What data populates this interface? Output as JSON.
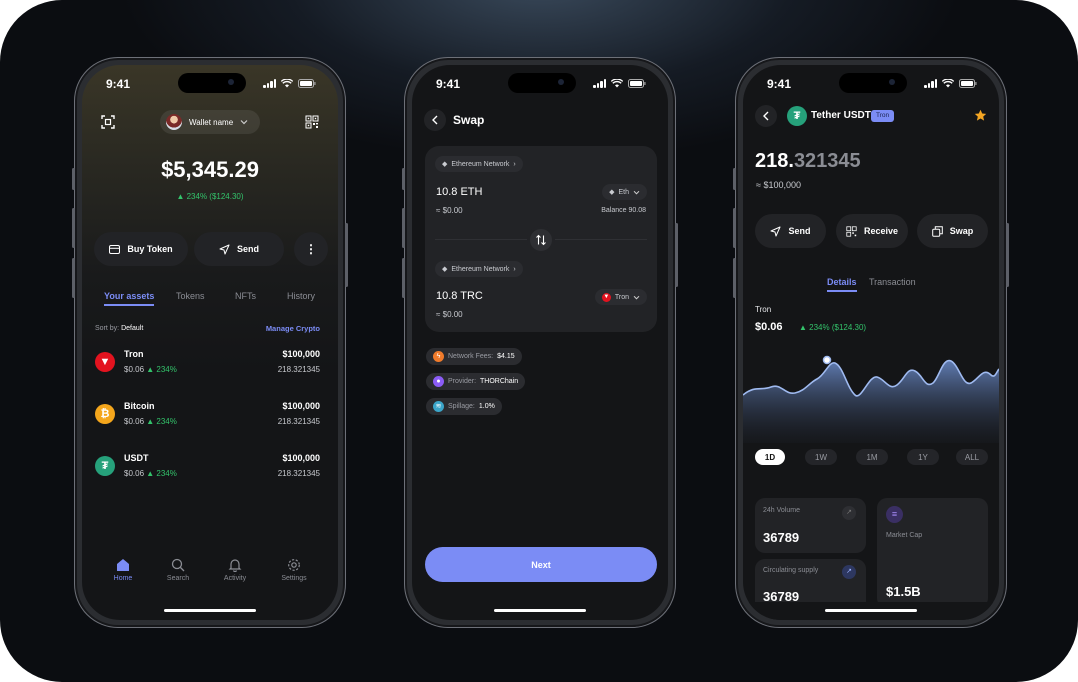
{
  "status": {
    "time": "9:41"
  },
  "home": {
    "wallet_name": "Wallet name",
    "balance": "$5,345.29",
    "change": "234% ($124.30)",
    "buy_label": "Buy Token",
    "send_label": "Send",
    "tabs": [
      "Your assets",
      "Tokens",
      "NFTs",
      "History"
    ],
    "sort_prefix": "Sort by:",
    "sort_value": "Default",
    "manage_label": "Manage Crypto",
    "assets": [
      {
        "name": "Tron",
        "price": "$0.06",
        "change": "234%",
        "value": "$100,000",
        "amount": "218.321345",
        "color": "#e3131f",
        "icon": "tron-icon"
      },
      {
        "name": "Bitcoin",
        "price": "$0.06",
        "change": "234%",
        "value": "$100,000",
        "amount": "218.321345",
        "color": "#f4a61c",
        "icon": "bitcoin-icon"
      },
      {
        "name": "USDT",
        "price": "$0.06",
        "change": "234%",
        "value": "$100,000",
        "amount": "218.321345",
        "color": "#26a17b",
        "icon": "tether-icon"
      }
    ],
    "nav": [
      "Home",
      "Search",
      "Activity",
      "Settings"
    ]
  },
  "swap": {
    "title": "Swap",
    "from_network": "Ethereum Network",
    "from_amount": "10.8 ETH",
    "from_token": "Eth",
    "from_fiat": "≈ $0.00",
    "balance": "Balance 90.08",
    "to_network": "Ethereum Network",
    "to_amount": "10.8 TRC",
    "to_token": "Tron",
    "to_fiat": "≈ $0.00",
    "fees_label": "Network Fees:",
    "fees_value": "$4.15",
    "provider_label": "Provider:",
    "provider_value": "THORChain",
    "spillage_label": "Spillage:",
    "spillage_value": "1.0%",
    "next_label": "Next"
  },
  "detail": {
    "title": "Tether USDT",
    "badge": "Tron",
    "amount_main": "218.",
    "amount_frac": "321345",
    "fiat": "≈ $100,000",
    "send_label": "Send",
    "receive_label": "Receive",
    "swap_label": "Swap",
    "tabs": [
      "Details",
      "Transaction"
    ],
    "chart_label": "Tron",
    "chart_price": "$0.06",
    "chart_change": "234% ($124.30)",
    "ranges": [
      "1D",
      "1W",
      "1M",
      "1Y",
      "ALL"
    ],
    "volume_label": "24h Volume",
    "volume_value": "36789",
    "market_cap_label": "Market Cap",
    "market_cap_value": "$1.5B",
    "supply_label": "Circulating supply",
    "supply_value": "36789"
  },
  "colors": {
    "accent": "#7b8cf5",
    "green": "#33c36b",
    "star": "#f5a623"
  }
}
